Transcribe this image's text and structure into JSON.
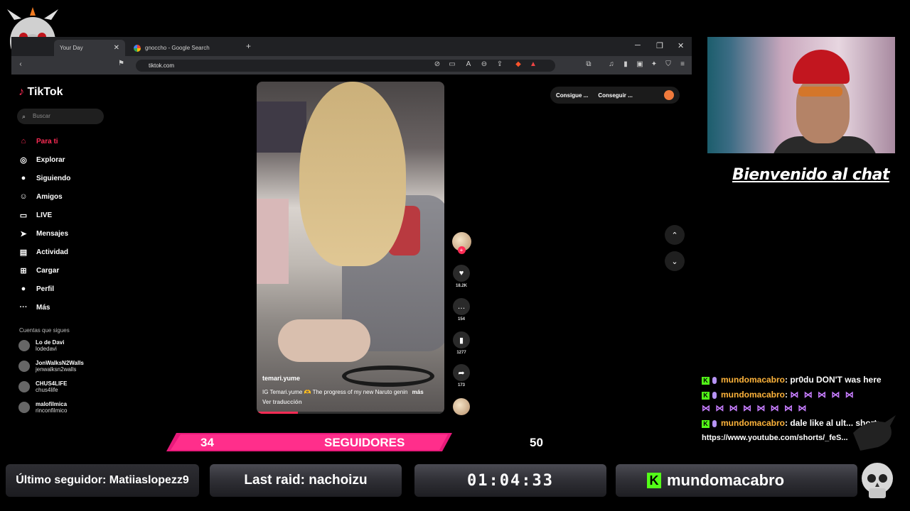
{
  "browser": {
    "tabs": [
      {
        "label": "Your Day",
        "active": true
      },
      {
        "label": "gnoccho - Google Search",
        "active": false
      }
    ],
    "url": "tiktok.com"
  },
  "tiktok": {
    "logo": "TikTok",
    "search_placeholder": "Buscar",
    "nav": [
      {
        "label": "Para ti",
        "icon": "home-icon",
        "glyph": "⌂",
        "active": true
      },
      {
        "label": "Explorar",
        "icon": "compass-icon",
        "glyph": "◎",
        "active": false
      },
      {
        "label": "Siguiendo",
        "icon": "following-icon",
        "glyph": "●",
        "active": false
      },
      {
        "label": "Amigos",
        "icon": "friends-icon",
        "glyph": "☺",
        "active": false
      },
      {
        "label": "LIVE",
        "icon": "live-icon",
        "glyph": "▭",
        "active": false
      },
      {
        "label": "Mensajes",
        "icon": "messages-icon",
        "glyph": "➤",
        "active": false
      },
      {
        "label": "Actividad",
        "icon": "activity-icon",
        "glyph": "▤",
        "active": false
      },
      {
        "label": "Cargar",
        "icon": "upload-icon",
        "glyph": "⊞",
        "active": false
      },
      {
        "label": "Perfil",
        "icon": "profile-icon",
        "glyph": "●",
        "active": false
      },
      {
        "label": "Más",
        "icon": "more-icon",
        "glyph": "···",
        "active": false
      }
    ],
    "following_title": "Cuentas que sigues",
    "following": [
      {
        "name": "Lo de Davi",
        "handle": "lodedavi"
      },
      {
        "name": "JonWalksN2Walls",
        "handle": "jenwalksn2walls"
      },
      {
        "name": "CHUS4LIFE",
        "handle": "chus4life"
      },
      {
        "name": "malofilmica",
        "handle": "rinconfilmico"
      }
    ],
    "promo": {
      "left": "Consigue ...",
      "right": "Conseguir ..."
    },
    "video": {
      "username": "temari.yume",
      "caption": "IG Temari.yume 🫶 The progress of my new Naruto genin",
      "more": "más",
      "translate": "Ver traducción",
      "progress": 0.22
    },
    "actions": {
      "likes": "18.2K",
      "comments": "154",
      "saves": "1277",
      "shares": "173"
    }
  },
  "overlay": {
    "welcome": "Bienvenido al chat",
    "followers_current": "34",
    "followers_label": "SEGUIDORES",
    "followers_goal": "50",
    "last_follower": "Último seguidor: Matiiaslopezz9",
    "last_raid": "Last raid: nachoizu",
    "timer": "01:04:33",
    "channel": "mundomacabro",
    "chat": [
      {
        "user": "mundomacabro",
        "message": ": pr0du DON'T was here"
      },
      {
        "user": "mundomacabro",
        "message": ": "
      },
      {
        "user": "mundomacabro",
        "message": ": dale like al ult... short:",
        "link": "https://www.youtube.com/shorts/_feS..."
      }
    ]
  }
}
